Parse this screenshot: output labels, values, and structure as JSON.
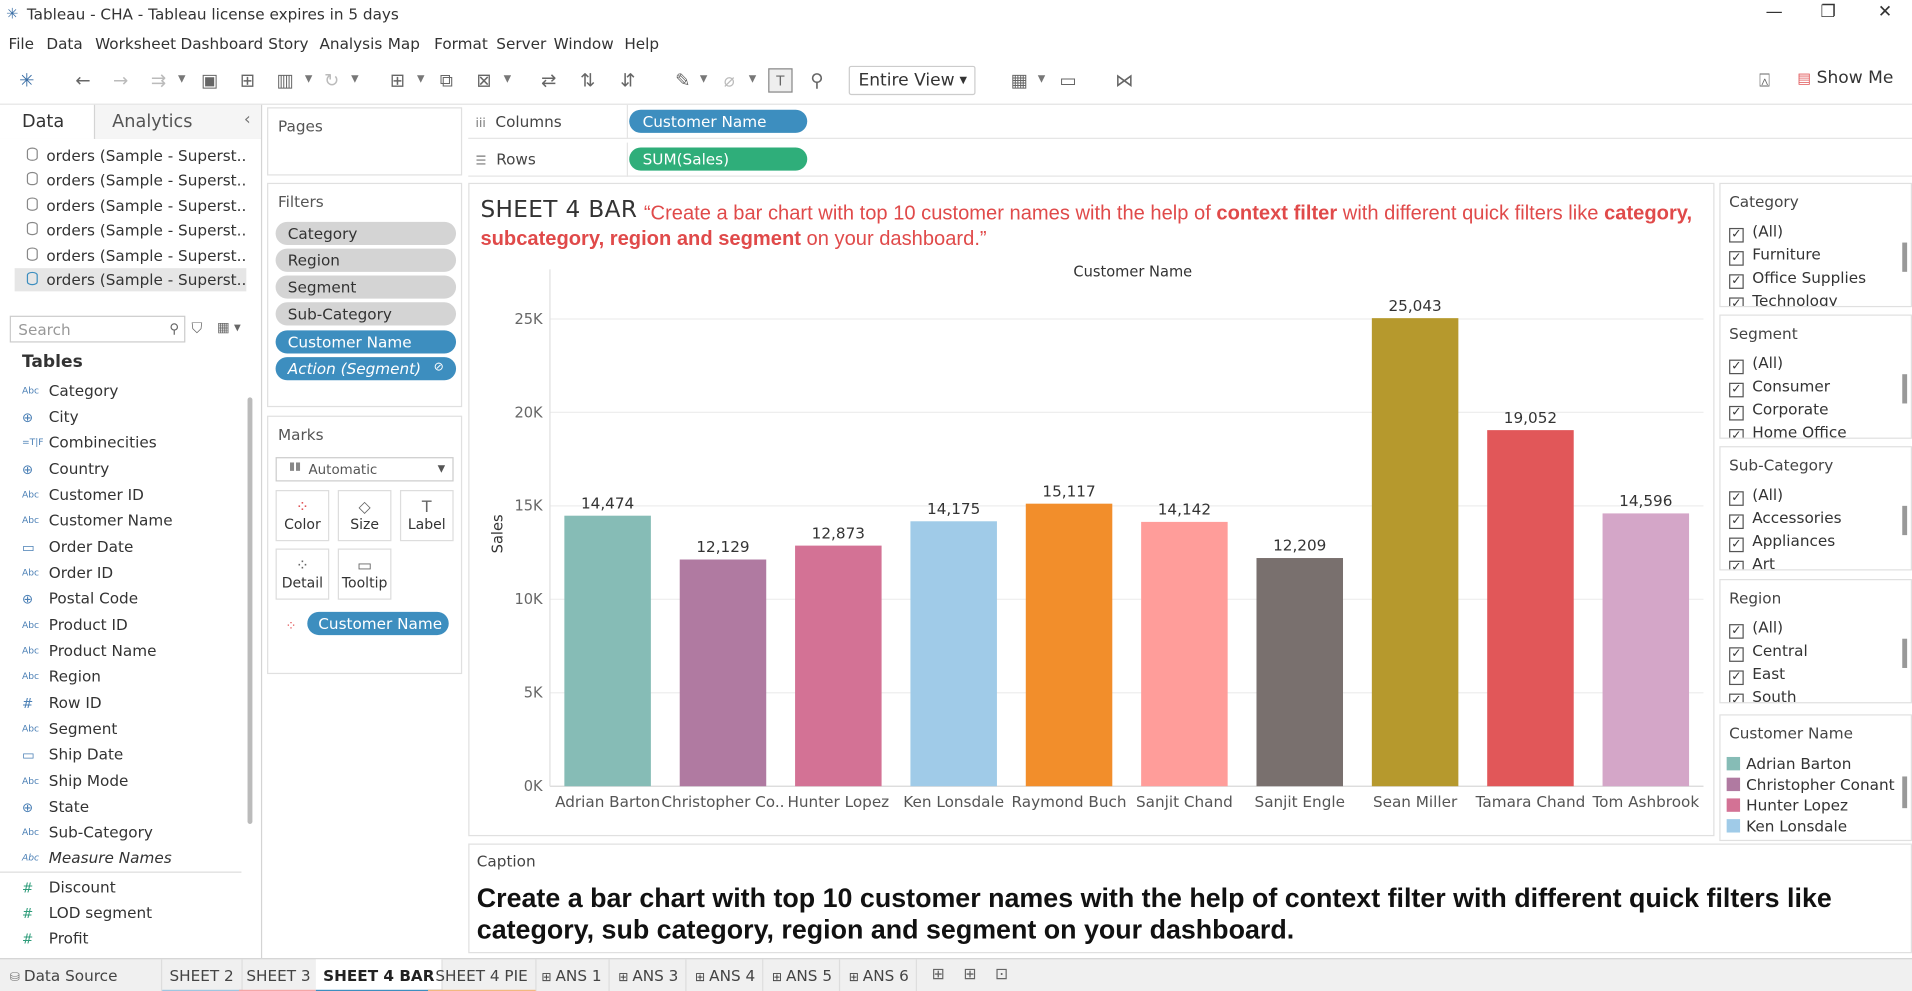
{
  "window": {
    "title": "Tableau - CHA - Tableau license expires in 5 days",
    "minimize": "—",
    "maximize": "❐",
    "close": "✕"
  },
  "menu": [
    "File",
    "Data",
    "Worksheet",
    "Dashboard",
    "Story",
    "Analysis",
    "Map",
    "Format",
    "Server",
    "Window",
    "Help"
  ],
  "toolbar": {
    "fit_value": "Entire View",
    "show_me": "Show Me"
  },
  "left_pane": {
    "tabs": [
      "Data",
      "Analytics"
    ],
    "collapse": "‹",
    "data_sources": [
      "orders (Sample - Superst...",
      "orders (Sample - Superst...",
      "orders (Sample - Superst...",
      "orders (Sample - Superst...",
      "orders (Sample - Superst...",
      "orders (Sample - Superst..."
    ],
    "search_placeholder": "Search",
    "tables_header": "Tables",
    "dimensions": [
      {
        "type": "Abc",
        "name": "Category"
      },
      {
        "type": "⊕",
        "name": "City"
      },
      {
        "type": "=T|F",
        "name": "Combinecities"
      },
      {
        "type": "⊕",
        "name": "Country"
      },
      {
        "type": "Abc",
        "name": "Customer ID"
      },
      {
        "type": "Abc",
        "name": "Customer Name"
      },
      {
        "type": "▭",
        "name": "Order Date"
      },
      {
        "type": "Abc",
        "name": "Order ID"
      },
      {
        "type": "⊕",
        "name": "Postal Code"
      },
      {
        "type": "Abc",
        "name": "Product ID"
      },
      {
        "type": "Abc",
        "name": "Product Name"
      },
      {
        "type": "Abc",
        "name": "Region"
      },
      {
        "type": "#",
        "name": "Row ID"
      },
      {
        "type": "Abc",
        "name": "Segment"
      },
      {
        "type": "▭",
        "name": "Ship Date"
      },
      {
        "type": "Abc",
        "name": "Ship Mode"
      },
      {
        "type": "⊕",
        "name": "State"
      },
      {
        "type": "Abc",
        "name": "Sub-Category"
      },
      {
        "type": "Abc",
        "name": "Measure Names"
      }
    ],
    "measures": [
      {
        "type": "#",
        "name": "Discount"
      },
      {
        "type": "#",
        "name": "LOD segment"
      },
      {
        "type": "#",
        "name": "Profit"
      }
    ]
  },
  "pages_label": "Pages",
  "filters": {
    "label": "Filters",
    "pills": [
      "Category",
      "Region",
      "Segment",
      "Sub-Category",
      "Customer Name",
      "Action (Segment)"
    ]
  },
  "marks": {
    "label": "Marks",
    "type": "Automatic",
    "buttons": [
      "Color",
      "Size",
      "Label",
      "Detail",
      "Tooltip"
    ],
    "color_pill": "Customer Name"
  },
  "shelves": {
    "columns_label": "Columns",
    "columns_pill": "Customer Name",
    "rows_label": "Rows",
    "rows_pill": "SUM(Sales)"
  },
  "sheet": {
    "title": "SHEET 4 BAR",
    "desc_part1": "“Create a bar chart with top 10 customer names with the help of ",
    "desc_bold1": "context filter",
    "desc_part2": " with different quick filters like ",
    "desc_bold2": "category, subcategory, region and segment",
    "desc_part3": "  on your dashboard.”"
  },
  "chart_data": {
    "type": "bar",
    "title": "Customer Name",
    "xlabel": "Customer Name",
    "ylabel": "Sales",
    "categories": [
      "Adrian Barton",
      "Christopher Co..",
      "Hunter Lopez",
      "Ken Lonsdale",
      "Raymond Buch",
      "Sanjit Chand",
      "Sanjit Engle",
      "Sean Miller",
      "Tamara Chand",
      "Tom Ashbrook"
    ],
    "values": [
      14474,
      12129,
      12873,
      14175,
      15117,
      14142,
      12209,
      25043,
      19052,
      14596
    ],
    "data_labels": [
      "14,474",
      "12,129",
      "12,873",
      "14,175",
      "15,117",
      "14,142",
      "12,209",
      "25,043",
      "19,052",
      "14,596"
    ],
    "colors": [
      "#86bcb6",
      "#b07aa1",
      "#d37295",
      "#a0cbe8",
      "#f28e2b",
      "#ff9d9a",
      "#79706e",
      "#b6992d",
      "#e15759",
      "#d4a6c8"
    ],
    "ylim": [
      0,
      27000
    ],
    "yticks": [
      0,
      5000,
      10000,
      15000,
      20000,
      25000
    ],
    "ytick_labels": [
      "0K",
      "5K",
      "10K",
      "15K",
      "20K",
      "25K"
    ],
    "grid": true,
    "legend": "right"
  },
  "quick_filters": [
    {
      "title": "Category",
      "items": [
        "(All)",
        "Furniture",
        "Office Supplies",
        "Technology"
      ]
    },
    {
      "title": "Segment",
      "items": [
        "(All)",
        "Consumer",
        "Corporate",
        "Home Office"
      ]
    },
    {
      "title": "Sub-Category",
      "items": [
        "(All)",
        "Accessories",
        "Appliances",
        "Art"
      ]
    },
    {
      "title": "Region",
      "items": [
        "(All)",
        "Central",
        "East",
        "South"
      ]
    }
  ],
  "legend": {
    "title": "Customer Name",
    "items": [
      {
        "name": "Adrian Barton",
        "color": "#86bcb6"
      },
      {
        "name": "Christopher Conant",
        "color": "#b07aa1"
      },
      {
        "name": "Hunter Lopez",
        "color": "#d37295"
      },
      {
        "name": "Ken Lonsdale",
        "color": "#a0cbe8"
      }
    ]
  },
  "caption": {
    "label": "Caption",
    "text": "Create a bar chart with top 10 customer names with the help of context filter with different quick filters like category, sub category, region and segment on your dashboard."
  },
  "bottom_tabs": {
    "data_source": "Data Source",
    "sheets": [
      "SHEET 2",
      "SHEET 3",
      "SHEET 4 BAR",
      "SHEET 4 PIE",
      "ANS 1",
      "ANS 3",
      "ANS 4",
      "ANS 5",
      "ANS 6"
    ],
    "active": "SHEET 4 BAR"
  }
}
